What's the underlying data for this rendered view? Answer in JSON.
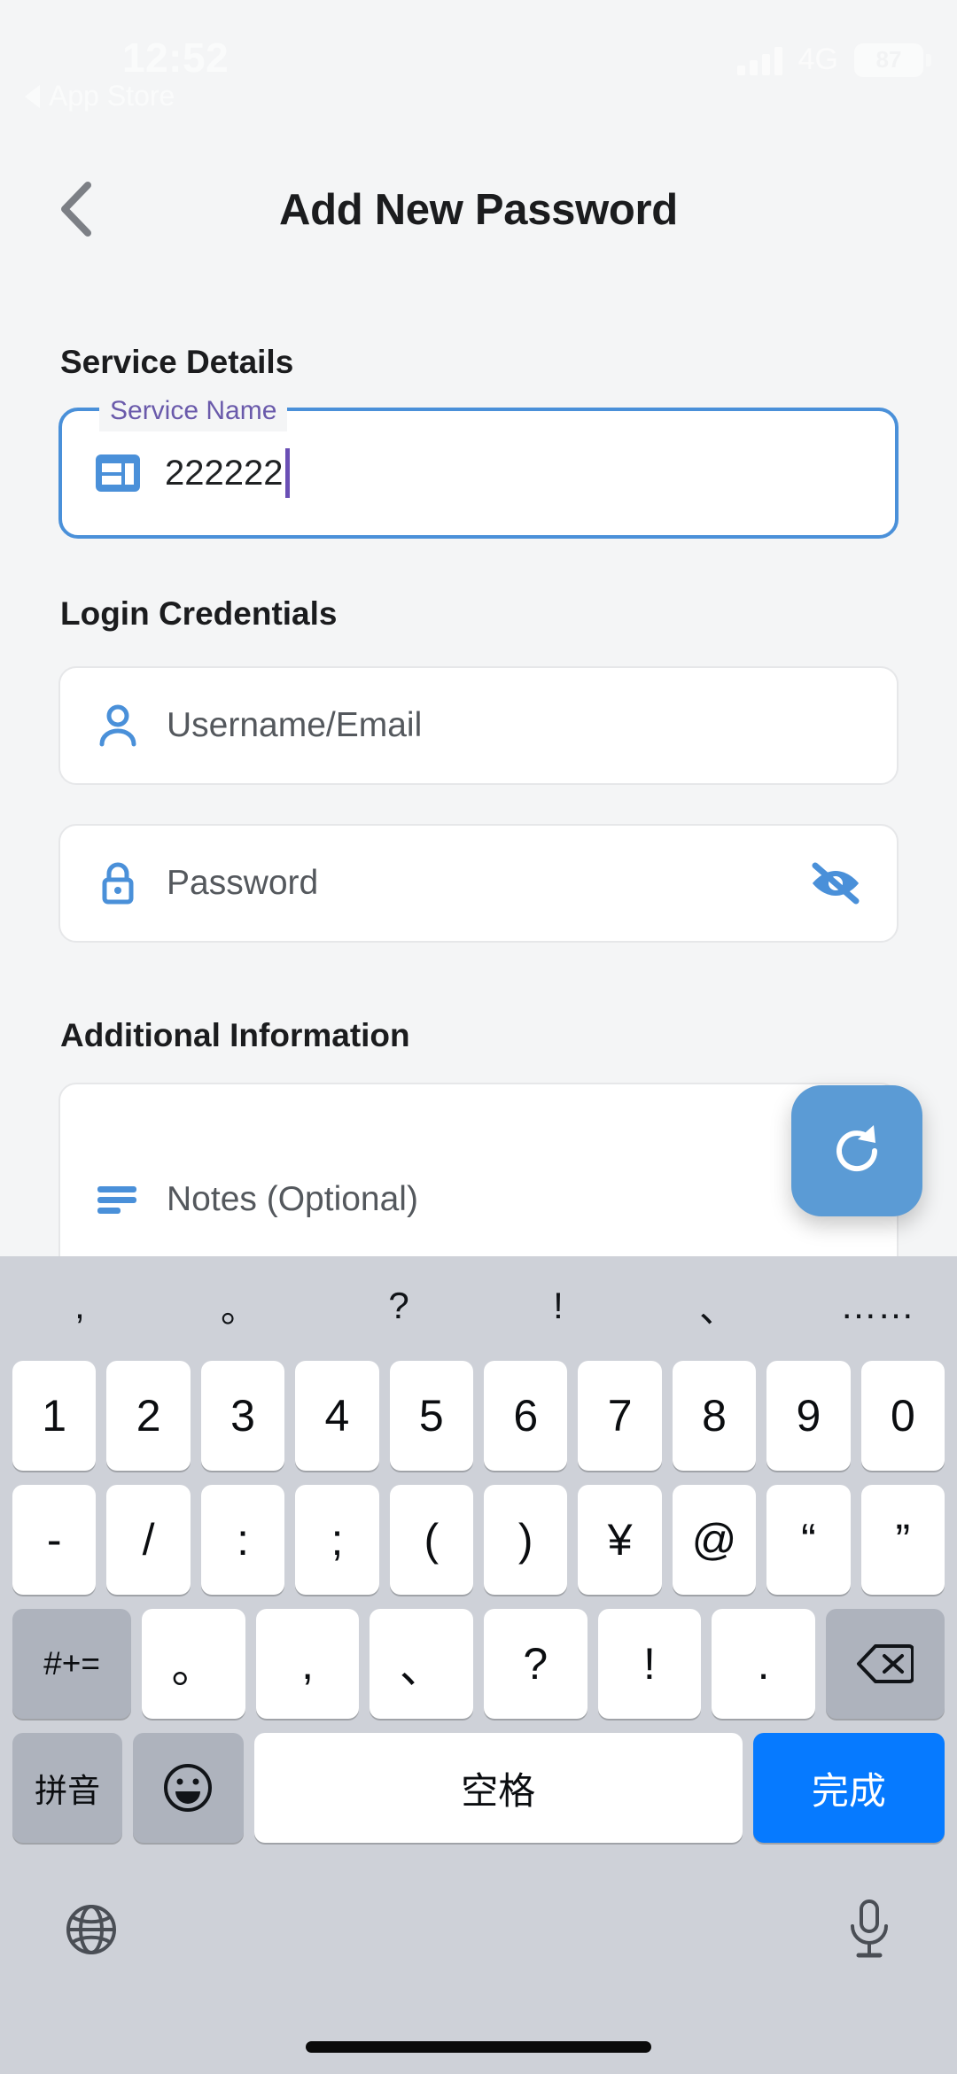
{
  "status_bar": {
    "time": "12:52",
    "back_app": "App Store",
    "network": "4G",
    "battery": "87",
    "signal_icon": "signal-bars-icon",
    "back_arrow_icon": "back-triangle-icon"
  },
  "nav": {
    "back_icon": "chevron-left-icon",
    "title": "Add New Password"
  },
  "sections": {
    "service": {
      "title": "Service Details",
      "field_label": "Service Name",
      "field_value": "222222",
      "field_icon": "web-asset-icon"
    },
    "login": {
      "title": "Login Credentials",
      "username_placeholder": "Username/Email",
      "username_icon": "person-icon",
      "password_placeholder": "Password",
      "password_icon": "lock-icon",
      "password_toggle_icon": "eye-off-icon"
    },
    "additional": {
      "title": "Additional Information",
      "notes_placeholder": "Notes (Optional)",
      "notes_icon": "notes-lines-icon"
    }
  },
  "fab": {
    "icon": "refresh-icon",
    "color": "#5b9bd5"
  },
  "colors": {
    "accent": "#4a90d9",
    "label": "#6a5aab",
    "caret": "#6a4fb5",
    "keyboard_bg": "#ced1d8",
    "key_blue": "#067aff"
  },
  "keyboard": {
    "punctuation_row": [
      ",",
      "。",
      "?",
      "!",
      "、",
      "……"
    ],
    "row1": [
      "1",
      "2",
      "3",
      "4",
      "5",
      "6",
      "7",
      "8",
      "9",
      "0"
    ],
    "row2": [
      "-",
      "/",
      ":",
      ";",
      "(",
      ")",
      "¥",
      "@",
      "“",
      "”"
    ],
    "row3_symbols_key": "#+=",
    "row3": [
      "。",
      ",",
      "、",
      "?",
      "!",
      "."
    ],
    "row3_backspace_icon": "backspace-icon",
    "row4_pinyin": "拼音",
    "row4_emoji_icon": "emoji-smiley-icon",
    "row4_space": "空格",
    "row4_done": "完成",
    "globe_icon": "globe-icon",
    "mic_icon": "microphone-icon"
  }
}
